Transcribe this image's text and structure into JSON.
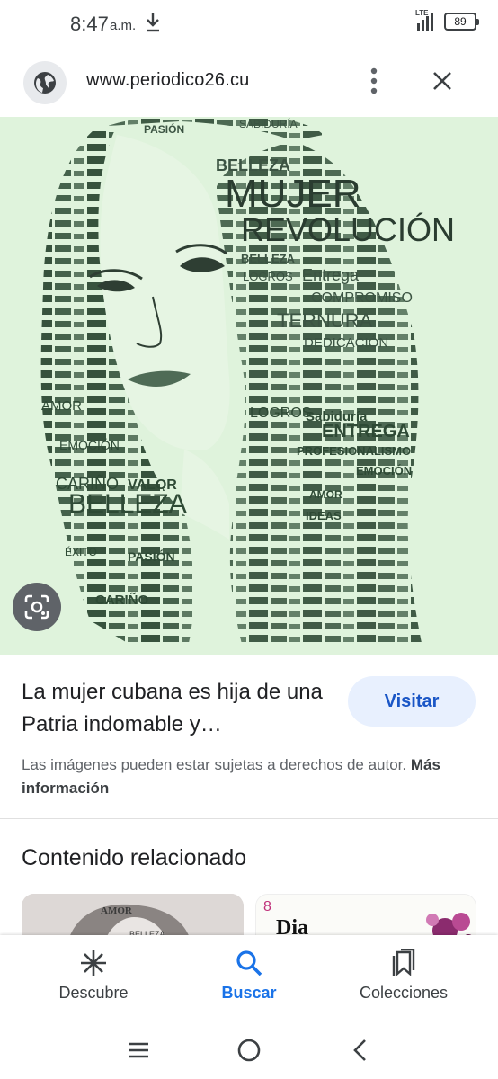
{
  "status_bar": {
    "time": "8:47",
    "ampm": "a.m.",
    "network": "LTE",
    "battery": "89",
    "icons": [
      "download-icon",
      "signal-icon",
      "battery-icon"
    ]
  },
  "header": {
    "url": "www.periodico26.cu",
    "icons": [
      "globe-icon",
      "more-vert-icon",
      "close-icon"
    ]
  },
  "image": {
    "words": {
      "mujer": "MUJER",
      "revolucion": "REVOLUCIÓN",
      "belleza": "BELLEZA",
      "logros": "LOGROS",
      "entrega": "Entrega",
      "compromiso": "COMPROMISO",
      "ternura": "TERNURA",
      "dedicacion": "DEDICACIÓN",
      "pasion": "PASIÓN",
      "sabiduria": "SABIDURÍA",
      "amor": "AMOR",
      "emocion": "EMOCIÓN",
      "carino": "CARIÑO",
      "valor": "VALOR",
      "profesionalismo": "PROFESIONALISMO",
      "ideas": "IDEAS",
      "exito": "ÉXITO",
      "entrega_caps": "ENTREGA",
      "sabiduria_2": "Sabiduría"
    },
    "lens_icon": "lens-icon",
    "colors": {
      "background": "#dff3dc",
      "text": "#2f4a36"
    }
  },
  "result": {
    "title": "La mujer cubana es hija de una Patria indomable y…",
    "visit_label": "Visitar",
    "copyright_text": "Las imágenes pueden estar sujetas a derechos de autor.",
    "more_info": "Más información"
  },
  "related": {
    "title": "Contenido relacionado",
    "thumb1": {
      "word1": "AMOR",
      "word2": "BELLEZA"
    },
    "thumb2": {
      "number": "8",
      "word": "Dia"
    }
  },
  "bottom_nav": {
    "items": [
      {
        "label": "Descubre",
        "icon": "asterisk-icon",
        "active": false
      },
      {
        "label": "Buscar",
        "icon": "search-icon",
        "active": true
      },
      {
        "label": "Colecciones",
        "icon": "bookmarks-icon",
        "active": false
      }
    ]
  },
  "system_nav": {
    "icons": [
      "recents-icon",
      "home-icon",
      "back-icon"
    ]
  },
  "colors": {
    "accent": "#1a73e8",
    "visit_bg": "#e8f0fe",
    "visit_text": "#1a56c6"
  }
}
